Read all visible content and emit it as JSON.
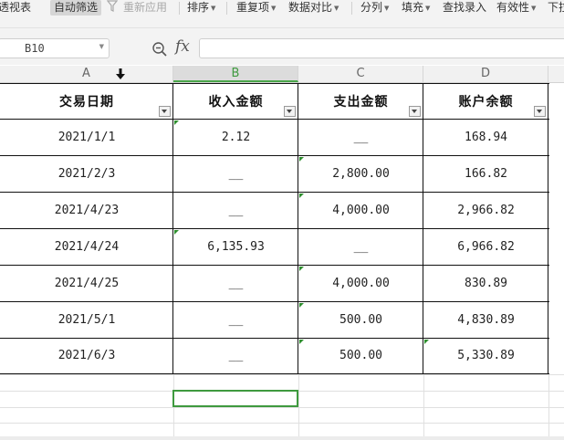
{
  "toolbar": {
    "items": [
      {
        "label": "透视表"
      },
      {
        "label": "自动筛选"
      },
      {
        "label": "重新应用"
      },
      {
        "label": "排序"
      },
      {
        "label": "重复项"
      },
      {
        "label": "数据对比"
      },
      {
        "label": "分列"
      },
      {
        "label": "填充"
      },
      {
        "label": "查找录入"
      },
      {
        "label": "有效性"
      },
      {
        "label": "下拉"
      }
    ]
  },
  "formula_bar": {
    "name_box": "B10",
    "fx_label": "fx",
    "formula": ""
  },
  "columns": [
    "A",
    "B",
    "C",
    "D"
  ],
  "selected_column": "B",
  "table": {
    "headers": [
      "交易日期",
      "收入金额",
      "支出金额",
      "账户余额"
    ],
    "rows": [
      [
        "2021/1/1",
        "2.12",
        "__",
        "168.94"
      ],
      [
        "2021/2/3",
        "__",
        "2,800.00",
        "166.82"
      ],
      [
        "2021/4/23",
        "__",
        "4,000.00",
        "2,966.82"
      ],
      [
        "2021/4/24",
        "6,135.93",
        "__",
        "6,966.82"
      ],
      [
        "2021/4/25",
        "__",
        "4,000.00",
        "830.89"
      ],
      [
        "2021/5/1",
        "__",
        "500.00",
        "4,830.89"
      ],
      [
        "2021/6/3",
        "__",
        "500.00",
        "5,330.89"
      ]
    ]
  },
  "colors": {
    "accent": "#3f9a3f",
    "toolbar_bg": "#f3f3f3",
    "text_marker": "#2f8f2f"
  }
}
